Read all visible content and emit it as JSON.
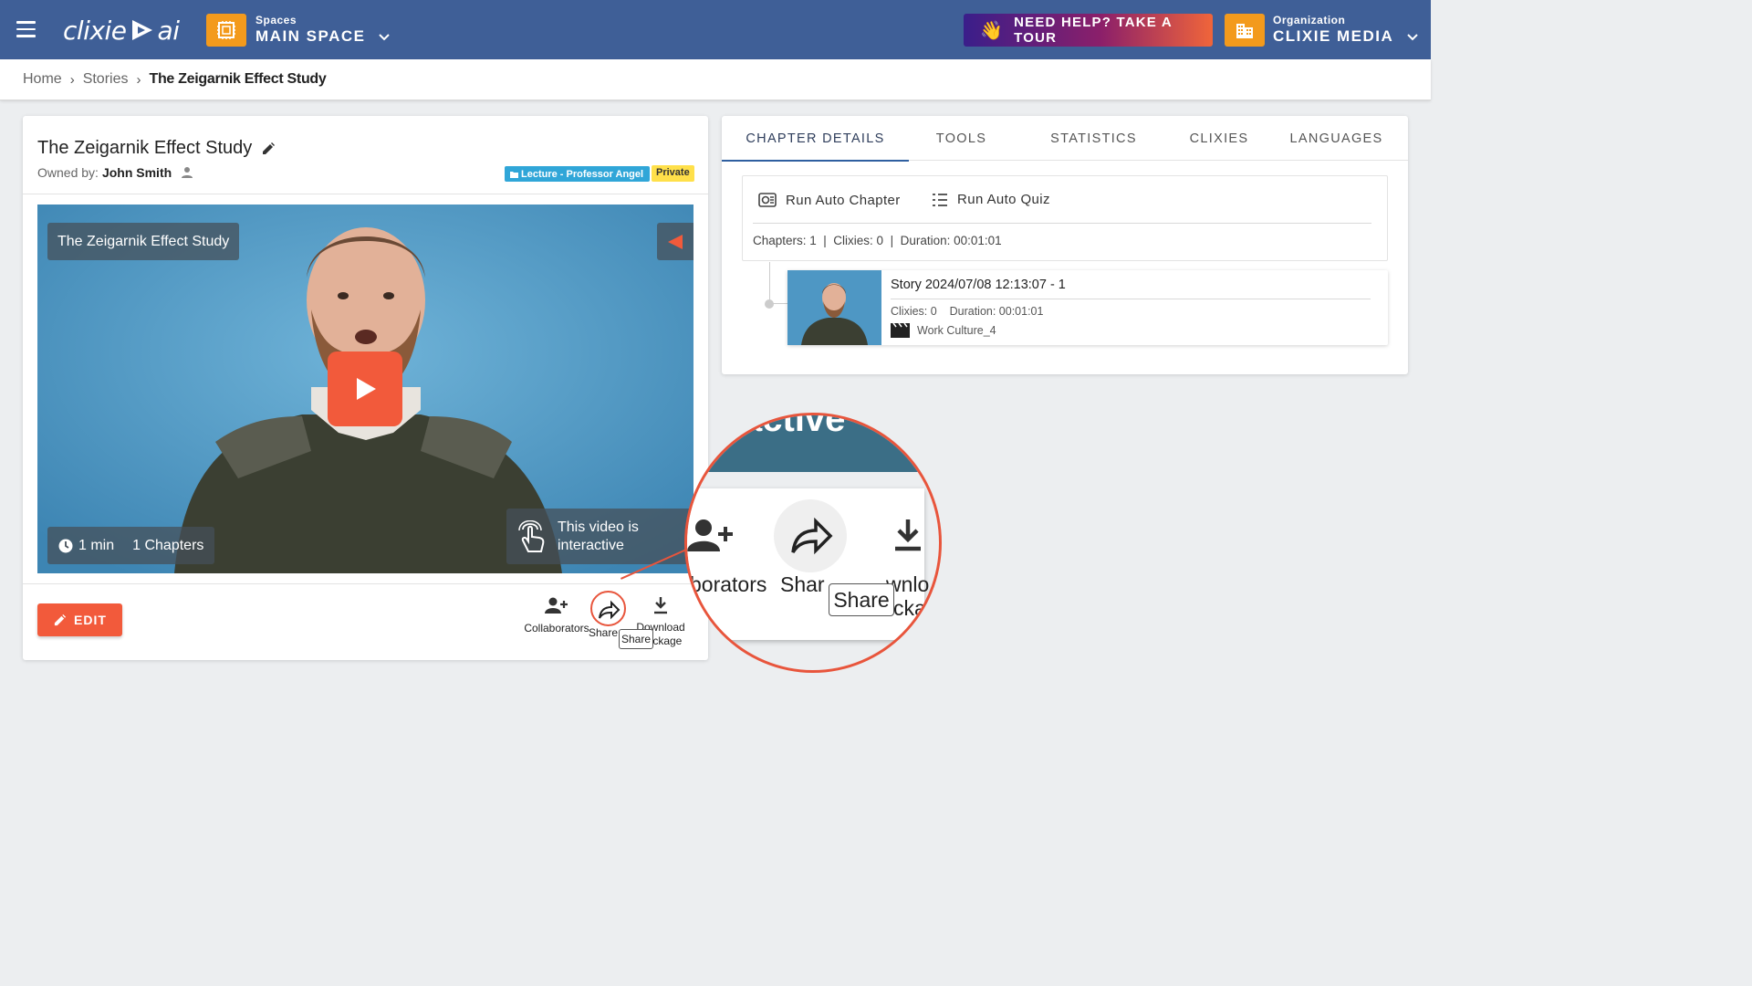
{
  "brand": {
    "logo_left": "clixie",
    "logo_right": "ai"
  },
  "header": {
    "spaces_caption": "Spaces",
    "spaces_value": "MAIN SPACE",
    "tour_label": "NEED HELP? TAKE A TOUR",
    "org_caption": "Organization",
    "org_value": "CLIXIE MEDIA"
  },
  "breadcrumb": {
    "home": "Home",
    "stories": "Stories",
    "current": "The Zeigarnik Effect Study"
  },
  "story": {
    "title": "The Zeigarnik Effect Study",
    "owned_label": "Owned by:",
    "owner": "John Smith",
    "tag_lecture": "Lecture - Professor Angel",
    "tag_private": "Private"
  },
  "video": {
    "overlay_title": "The Zeigarnik Effect Study",
    "duration": "1 min",
    "chapters": "1 Chapters",
    "interactive_line1": "This video is",
    "interactive_line2": "interactive"
  },
  "actions": {
    "edit": "EDIT",
    "collaborators": "Collaborators",
    "share": "Share",
    "download": "Download Package",
    "tooltip": "Share"
  },
  "tabs": [
    "CHAPTER DETAILS",
    "TOOLS",
    "STATISTICS",
    "CLIXIES",
    "LANGUAGES"
  ],
  "chapter_details": {
    "run_auto_chapter": "Run Auto Chapter",
    "run_auto_quiz": "Run Auto Quiz",
    "summary": "Chapters: 1  |  Clixies: 0  |  Duration: 00:01:01",
    "item": {
      "title": "Story 2024/07/08 12:13:07 - 1",
      "stats": "Clixies: 0    Duration: 00:01:01",
      "media": "Work Culture_4"
    }
  },
  "zoom": {
    "bar_fragment": "active",
    "collab_fragment": "borators",
    "share_fragment": "Shar",
    "download_fragment1": "wnlo",
    "download_fragment2": "cka",
    "tooltip": "Share"
  },
  "colors": {
    "header": "#3f5f97",
    "accent": "#f25a3b",
    "orange": "#f39a1c",
    "tag_blue": "#30a6d8",
    "tag_yellow": "#ffe04a"
  }
}
